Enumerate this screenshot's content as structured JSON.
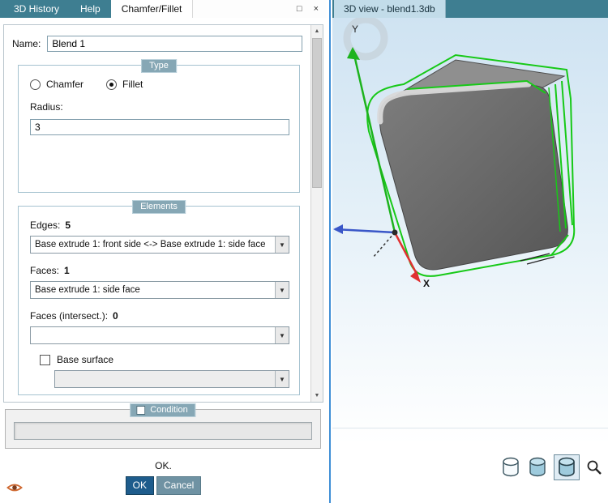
{
  "icons": {
    "maximize": "□",
    "close": "×",
    "dropdown_arrow": "▼",
    "scroll_up": "▲",
    "scroll_down": "▼"
  },
  "colors": {
    "header_teal": "#3e7e91",
    "badge_teal": "#86a7b5",
    "ok_button": "#1e5c8c",
    "cancel_button": "#6f92a3",
    "selection_green": "#17c917"
  },
  "left_tabs": [
    {
      "label": "3D History"
    },
    {
      "label": "Help"
    },
    {
      "label": "Chamfer/Fillet"
    }
  ],
  "dialog": {
    "name_label": "Name:",
    "name_value": "Blend 1",
    "type_group": {
      "title": "Type",
      "options": [
        "Chamfer",
        "Fillet"
      ],
      "selected": "Fillet",
      "radius_label": "Radius:",
      "radius_value": "3"
    },
    "elements_group": {
      "title": "Elements",
      "edges_label": "Edges:",
      "edges_count": "5",
      "edges_value": "Base extrude 1: front side <-> Base extrude 1: side face",
      "faces_label": "Faces:",
      "faces_count": "1",
      "faces_value": "Base extrude 1: side face",
      "faces_intersect_label": "Faces (intersect.):",
      "faces_intersect_count": "0",
      "faces_intersect_value": "",
      "base_surface_label": "Base surface",
      "base_surface_value": ""
    },
    "condition_group": {
      "title": "Condition",
      "value": ""
    },
    "status_text": "OK.",
    "ok_label": "OK",
    "cancel_label": "Cancel"
  },
  "right_panel": {
    "tab_label": "3D view - blend1.3db",
    "axes": {
      "x_label": "X",
      "y_label": "Y"
    }
  }
}
